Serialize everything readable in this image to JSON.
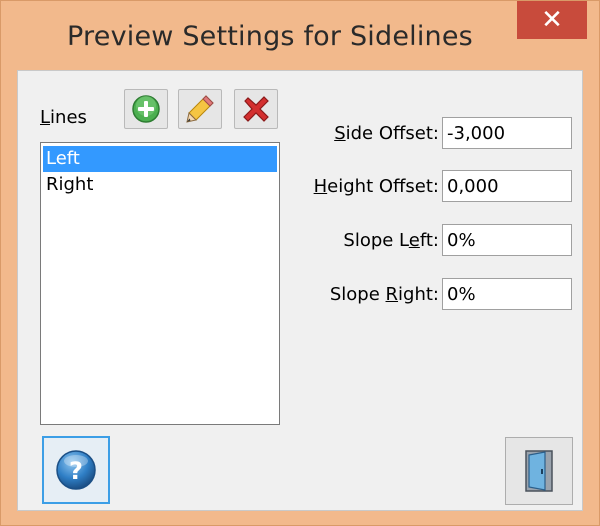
{
  "window": {
    "title": "Preview Settings for Sidelines",
    "close_glyph": "✕"
  },
  "lines": {
    "label_underlined": "L",
    "label_rest": "ines",
    "items": [
      "Left",
      "Right"
    ],
    "selected_index": 0,
    "toolbar": {
      "add_icon": "add-icon",
      "edit_icon": "pencil-icon",
      "delete_icon": "delete-icon"
    }
  },
  "fields": {
    "side_offset": {
      "label_pre": "",
      "label_u": "S",
      "label_post": "ide Offset:",
      "value": "-3,000"
    },
    "height_offset": {
      "label_pre": "",
      "label_u": "H",
      "label_post": "eight Offset:",
      "value": "0,000"
    },
    "slope_left": {
      "label_pre": "Slope L",
      "label_u": "e",
      "label_post": "ft:",
      "value": "0%"
    },
    "slope_right": {
      "label_pre": "Slope ",
      "label_u": "R",
      "label_post": "ight:",
      "value": "0%"
    }
  },
  "colors": {
    "title_bar": "#f2b98c",
    "close_button": "#c84b3c",
    "selection": "#3399ff"
  }
}
